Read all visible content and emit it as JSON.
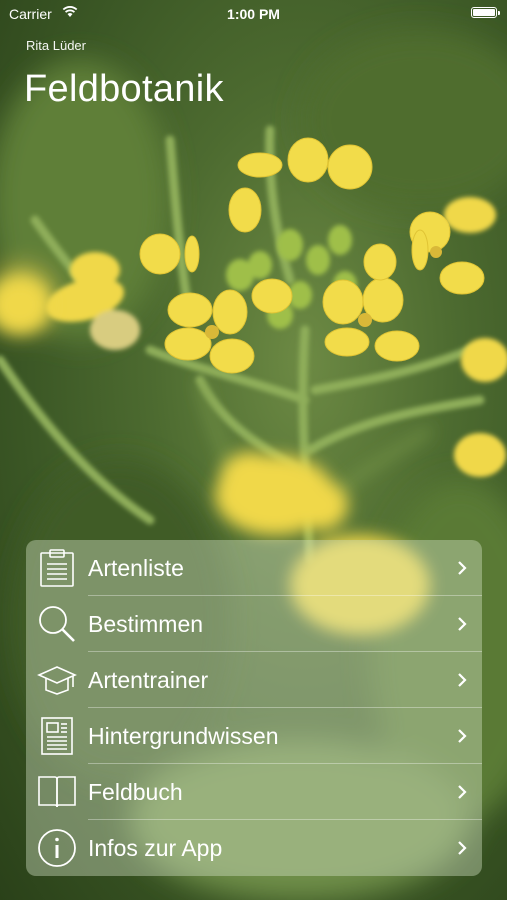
{
  "status_bar": {
    "carrier": "Carrier",
    "time": "1:00 PM"
  },
  "header": {
    "author": "Rita Lüder",
    "title": "Feldbotanik"
  },
  "menu": {
    "items": [
      {
        "label": "Artenliste",
        "icon": "clipboard-list-icon"
      },
      {
        "label": "Bestimmen",
        "icon": "magnifier-icon"
      },
      {
        "label": "Artentrainer",
        "icon": "graduation-cap-icon"
      },
      {
        "label": "Hintergrundwissen",
        "icon": "document-icon"
      },
      {
        "label": "Feldbuch",
        "icon": "open-book-icon"
      },
      {
        "label": "Infos zur App",
        "icon": "info-icon"
      }
    ]
  },
  "colors": {
    "text": "#ffffff",
    "flower": "#f2dc4a",
    "stem": "#8fae5a"
  }
}
